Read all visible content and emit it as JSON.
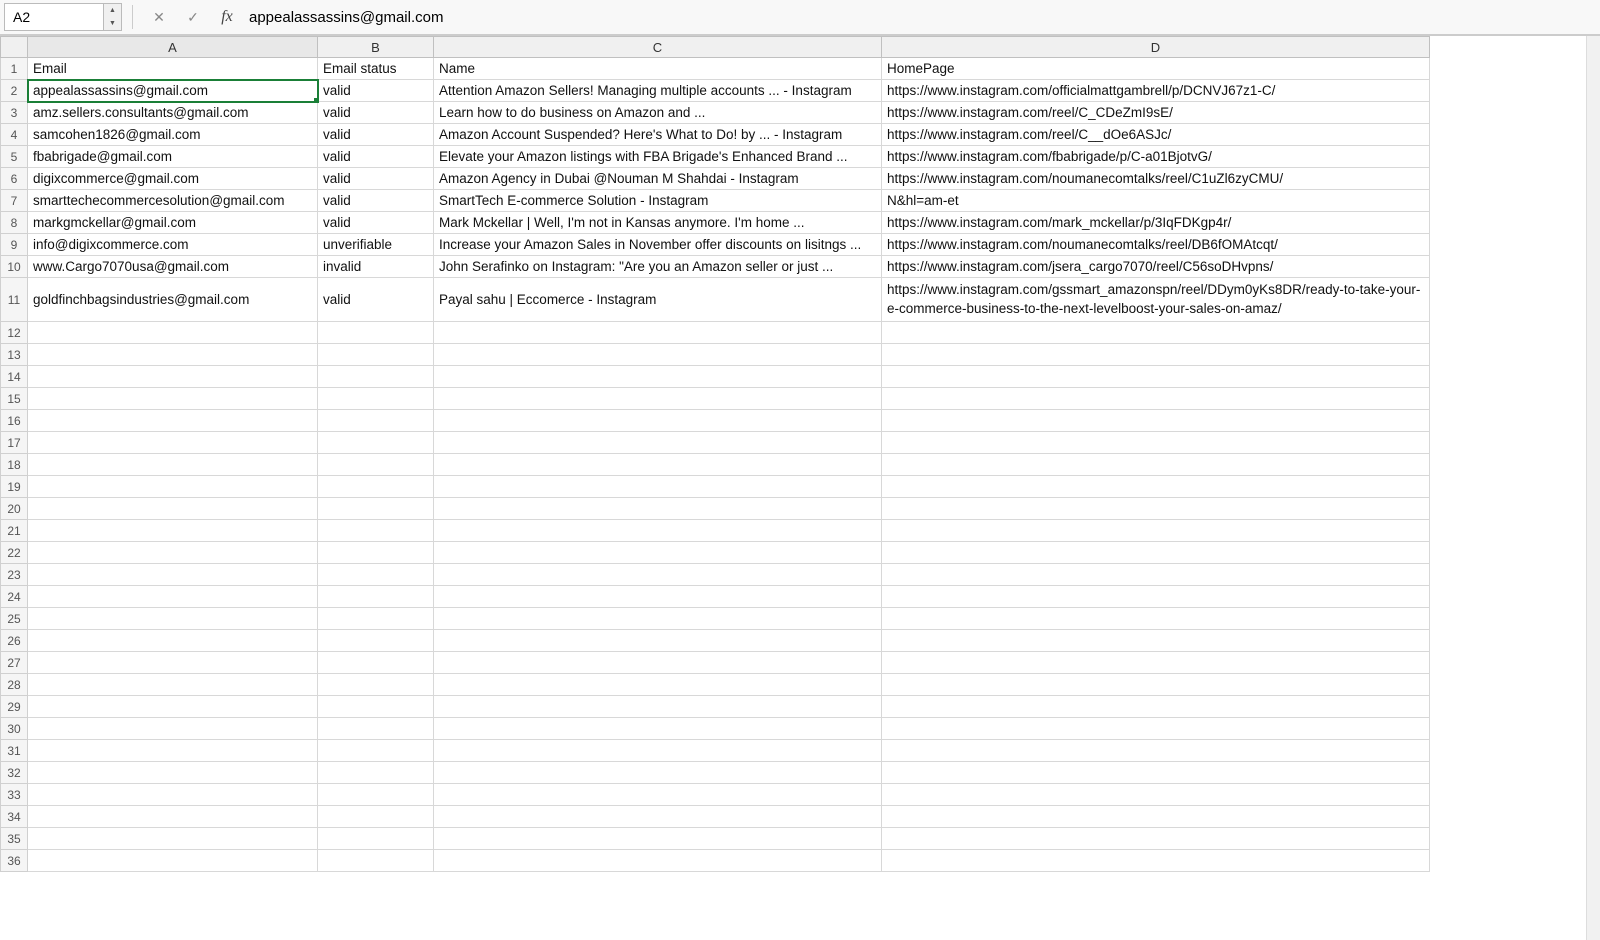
{
  "formula_bar": {
    "cell_ref": "A2",
    "cancel_icon": "✕",
    "accept_icon": "✓",
    "fx_label": "fx",
    "formula_value": "appealassassins@gmail.com"
  },
  "columns": [
    "A",
    "B",
    "C",
    "D"
  ],
  "headers": {
    "A": "Email",
    "B": "Email status",
    "C": "Name",
    "D": "HomePage"
  },
  "rows": [
    {
      "n": 2,
      "A": "appealassassins@gmail.com",
      "B": "valid",
      "C": "Attention Amazon Sellers! Managing multiple accounts ... - Instagram",
      "D": "https://www.instagram.com/officialmattgambrell/p/DCNVJ67z1-C/"
    },
    {
      "n": 3,
      "A": "amz.sellers.consultants@gmail.com",
      "B": "valid",
      "C": "Learn how to do business on Amazon and ...",
      "D": "https://www.instagram.com/reel/C_CDeZmI9sE/"
    },
    {
      "n": 4,
      "A": "samcohen1826@gmail.com",
      "B": "valid",
      "C": "Amazon Account Suspended? Here's What to Do! by ... - Instagram",
      "D": "https://www.instagram.com/reel/C__dOe6ASJc/"
    },
    {
      "n": 5,
      "A": "fbabrigade@gmail.com",
      "B": "valid",
      "C": "Elevate your Amazon listings with FBA Brigade's Enhanced Brand ...",
      "D": "https://www.instagram.com/fbabrigade/p/C-a01BjotvG/"
    },
    {
      "n": 6,
      "A": "digixcommerce@gmail.com",
      "B": "valid",
      "C": "Amazon Agency in Dubai @Nouman M Shahdai - Instagram",
      "D": "https://www.instagram.com/noumanecomtalks/reel/C1uZl6zyCMU/"
    },
    {
      "n": 7,
      "A": "smarttechecommercesolution@gmail.com",
      "B": "valid",
      "C": "SmartTech E-commerce Solution - Instagram",
      "D": "N&hl=am-et"
    },
    {
      "n": 8,
      "A": "markgmckellar@gmail.com",
      "B": "valid",
      "C": "Mark Mckellar | Well, I'm not in Kansas anymore. I'm home ...",
      "D": "https://www.instagram.com/mark_mckellar/p/3IqFDKgp4r/"
    },
    {
      "n": 9,
      "A": "info@digixcommerce.com",
      "B": "unverifiable",
      "C": "Increase your Amazon Sales in November offer discounts on lisitngs ...",
      "D": "https://www.instagram.com/noumanecomtalks/reel/DB6fOMAtcqt/"
    },
    {
      "n": 10,
      "A": "www.Cargo7070usa@gmail.com",
      "B": "invalid",
      "C": "John Serafinko on Instagram: \"Are you an Amazon seller or just ...",
      "D": "https://www.instagram.com/jsera_cargo7070/reel/C56soDHvpns/"
    },
    {
      "n": 11,
      "A": "goldfinchbagsindustries@gmail.com",
      "B": "valid",
      "C": "Payal sahu | Eccomerce - Instagram",
      "D": "https://www.instagram.com/gssmart_amazonspn/reel/DDym0yKs8DR/ready-to-take-your-e-commerce-business-to-the-next-levelboost-your-sales-on-amaz/",
      "tall": true
    }
  ],
  "empty_rows": [
    12,
    13,
    14,
    15,
    16,
    17,
    18,
    19,
    20,
    21,
    22,
    23,
    24,
    25,
    26,
    27,
    28,
    29,
    30,
    31,
    32,
    33,
    34,
    35,
    36
  ],
  "selected_cell": "A2"
}
